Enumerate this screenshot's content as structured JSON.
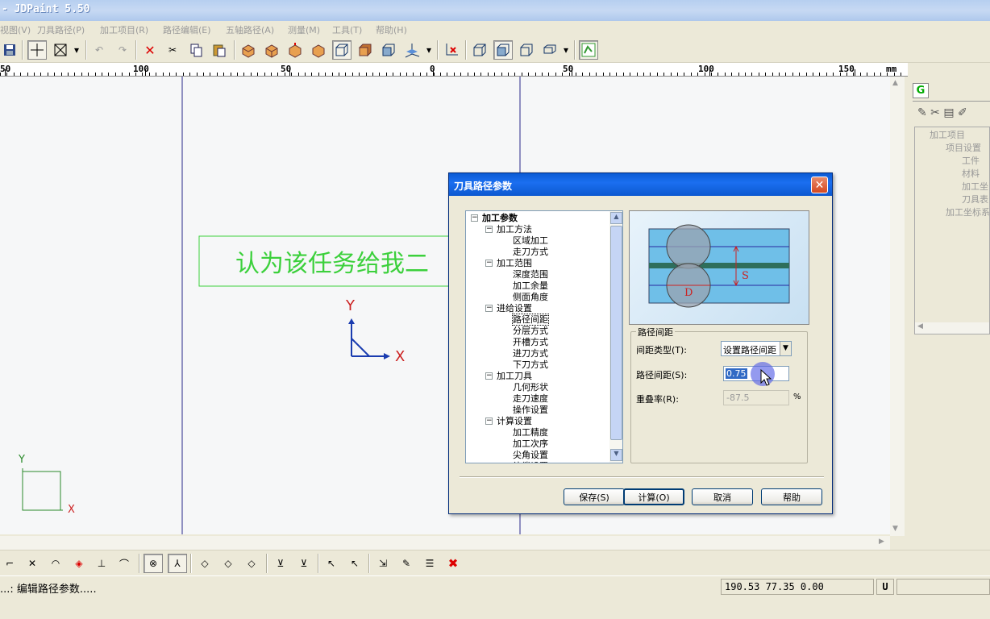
{
  "window": {
    "title": "- JDPaint 5.50"
  },
  "menu": [
    "视图(V)",
    "刀具路径(P)",
    "加工项目(R)",
    "路径编辑(E)",
    "五轴路径(A)",
    "测量(M)",
    "工具(T)",
    "帮助(H)"
  ],
  "ruler": {
    "labels": [
      "50",
      "100",
      "50",
      "0",
      "50",
      "100",
      "150"
    ],
    "unit": "mm"
  },
  "canvas": {
    "text": "认为该任务给我二",
    "axis_x": "X",
    "axis_y": "Y",
    "mini_axis_x": "X",
    "mini_axis_y": "Y"
  },
  "right_panel": {
    "tab": "G",
    "tree": [
      "加工项目",
      "项目设置",
      "工件",
      "材料",
      "加工坐",
      "刀具表",
      "加工坐标系"
    ]
  },
  "dialog": {
    "title": "刀具路径参数",
    "tree": [
      {
        "label": "加工参数",
        "level": 0,
        "bold": true
      },
      {
        "label": "加工方法",
        "level": 1
      },
      {
        "label": "区域加工",
        "level": 2
      },
      {
        "label": "走刀方式",
        "level": 2
      },
      {
        "label": "加工范围",
        "level": 1
      },
      {
        "label": "深度范围",
        "level": 2
      },
      {
        "label": "加工余量",
        "level": 2
      },
      {
        "label": "侧面角度",
        "level": 2
      },
      {
        "label": "进给设置",
        "level": 1
      },
      {
        "label": "路径间距",
        "level": 2,
        "selected": true
      },
      {
        "label": "分层方式",
        "level": 2
      },
      {
        "label": "开槽方式",
        "level": 2
      },
      {
        "label": "进刀方式",
        "level": 2
      },
      {
        "label": "下刀方式",
        "level": 2
      },
      {
        "label": "加工刀具",
        "level": 1
      },
      {
        "label": "几何形状",
        "level": 2
      },
      {
        "label": "走刀速度",
        "level": 2
      },
      {
        "label": "操作设置",
        "level": 2
      },
      {
        "label": "计算设置",
        "level": 1
      },
      {
        "label": "加工精度",
        "level": 2
      },
      {
        "label": "加工次序",
        "level": 2
      },
      {
        "label": "尖角设置",
        "level": 2
      },
      {
        "label": "补偿设置",
        "level": 2
      }
    ],
    "preview": {
      "label_d": "D",
      "label_s": "S"
    },
    "group_title": "路径间距",
    "spacing_type_label": "间距类型(T):",
    "spacing_type_value": "设置路径间距",
    "spacing_label": "路径间距(S):",
    "spacing_value": "0.75",
    "overlap_label": "重叠率(R):",
    "overlap_value": "-87.5",
    "overlap_unit": "%",
    "buttons": {
      "save": "保存(S)",
      "calc": "计算(O)",
      "cancel": "取消",
      "help": "帮助"
    }
  },
  "status": {
    "message": "...: 编辑路径参数.....",
    "coords": "190.53 77.35 0.00",
    "mode": "U"
  },
  "colors": {
    "accent": "#0a5ad4",
    "canvas_text": "#3cd03c",
    "axis": "#0a2bb0"
  }
}
